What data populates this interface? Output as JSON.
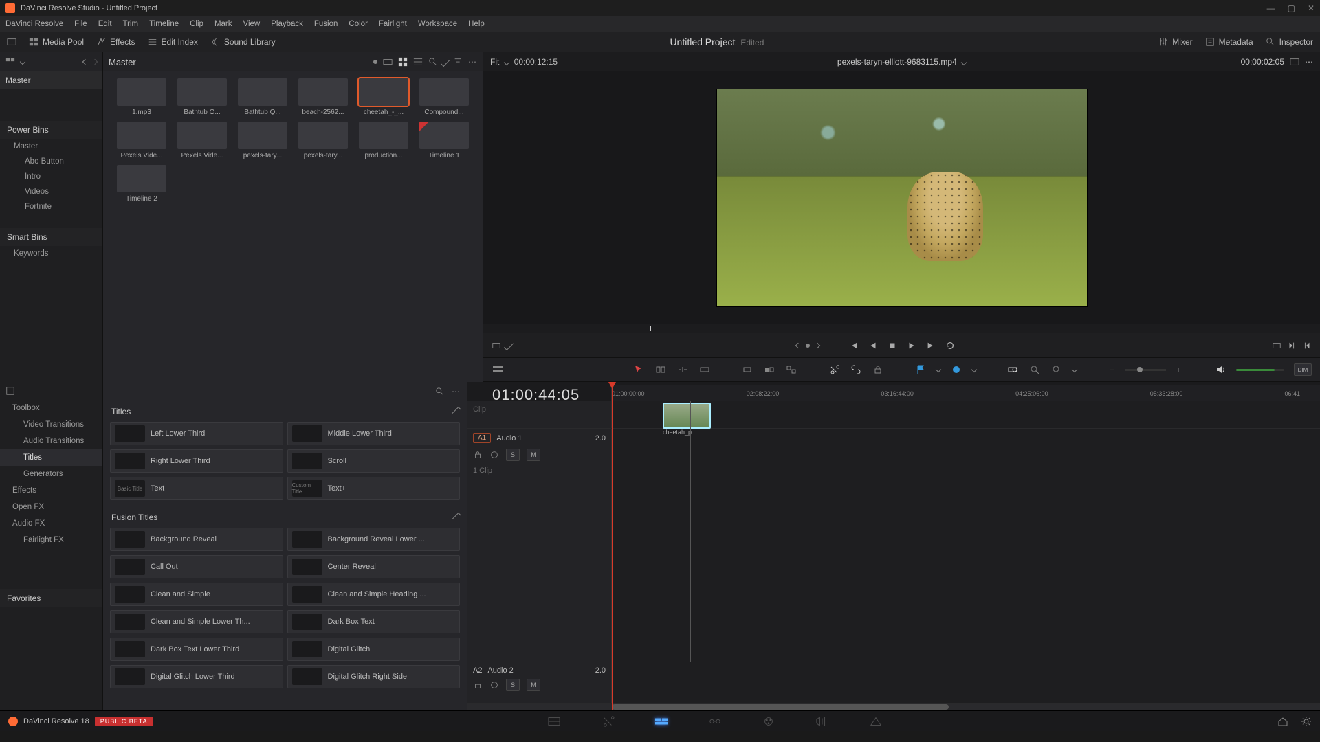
{
  "window": {
    "title": "DaVinci Resolve Studio - Untitled Project"
  },
  "menubar": [
    "DaVinci Resolve",
    "File",
    "Edit",
    "Trim",
    "Timeline",
    "Clip",
    "Mark",
    "View",
    "Playback",
    "Fusion",
    "Color",
    "Fairlight",
    "Workspace",
    "Help"
  ],
  "toolbar": {
    "media_pool": "Media Pool",
    "effects": "Effects",
    "edit_index": "Edit Index",
    "sound_library": "Sound Library",
    "project": "Untitled Project",
    "edited": "Edited",
    "mixer": "Mixer",
    "metadata": "Metadata",
    "inspector": "Inspector"
  },
  "bins": {
    "breadcrumb": "Master",
    "root": "Master",
    "power_title": "Power Bins",
    "power_items": [
      "Master",
      "Abo Button",
      "Intro",
      "Videos",
      "Fortnite"
    ],
    "smart_title": "Smart Bins",
    "smart_items": [
      "Keywords"
    ]
  },
  "mediapool": {
    "thumbs": [
      {
        "label": "1.mp3",
        "cls": "t-audio"
      },
      {
        "label": "Bathtub O...",
        "cls": "t-dark"
      },
      {
        "label": "Bathtub Q...",
        "cls": "t-dark"
      },
      {
        "label": "beach-2562...",
        "cls": "t-beach"
      },
      {
        "label": "cheetah_-_...",
        "cls": "t-cheetah",
        "sel": true
      },
      {
        "label": "Compound...",
        "cls": "t-comp"
      },
      {
        "label": "Pexels Vide...",
        "cls": "t-grey"
      },
      {
        "label": "Pexels Vide...",
        "cls": "t-grey"
      },
      {
        "label": "pexels-tary...",
        "cls": "t-grey"
      },
      {
        "label": "pexels-tary...",
        "cls": "t-grey"
      },
      {
        "label": "production...",
        "cls": "t-cheetah"
      },
      {
        "label": "Timeline 1",
        "cls": "t-tl"
      },
      {
        "label": "Timeline 2",
        "cls": "t-grey"
      }
    ]
  },
  "viewer": {
    "fit": "Fit",
    "src_tc": "00:00:12:15",
    "clip_name": "pexels-taryn-elliott-9683115.mp4",
    "rec_tc": "00:00:02:05"
  },
  "timeline": {
    "tc": "01:00:44:05",
    "ruler": [
      "01:00:00:00",
      "02:08:22:00",
      "03:16:44:00",
      "04:25:06:00",
      "05:33:28:00",
      "06:41"
    ],
    "a1_label": "A1",
    "a1_name": "Audio 1",
    "a1_gain": "2.0",
    "a1_clips": "1 Clip",
    "a2_label": "A2",
    "a2_name": "Audio 2",
    "a2_gain": "2.0",
    "drag_clip": "cheetah_p...",
    "btn_s": "S",
    "btn_m": "M"
  },
  "fx": {
    "search_ph": "Search",
    "cats": [
      {
        "name": "Toolbox",
        "exp": true
      },
      {
        "name": "Video Transitions",
        "child": true
      },
      {
        "name": "Audio Transitions",
        "child": true
      },
      {
        "name": "Titles",
        "child": true,
        "sel": true
      },
      {
        "name": "Generators",
        "child": true
      },
      {
        "name": "Effects",
        "exp": true
      },
      {
        "name": "Open FX",
        "exp": true
      },
      {
        "name": "Audio FX",
        "exp": true
      },
      {
        "name": "Fairlight FX",
        "child": true
      }
    ],
    "fav_title": "Favorites",
    "titles_hdr": "Titles",
    "fusion_hdr": "Fusion Titles",
    "titles": [
      "Left Lower Third",
      "Middle Lower Third",
      "Right Lower Third",
      "Scroll",
      "Text",
      "Text+"
    ],
    "titles_sw": [
      "",
      "",
      "",
      "",
      "Basic Title",
      "Custom Title"
    ],
    "fusion": [
      "Background Reveal",
      "Background Reveal Lower ...",
      "Call Out",
      "Center Reveal",
      "Clean and Simple",
      "Clean and Simple Heading ...",
      "Clean and Simple Lower Th...",
      "Dark Box Text",
      "Dark Box Text Lower Third",
      "Digital Glitch",
      "Digital Glitch Lower Third",
      "Digital Glitch Right Side"
    ]
  },
  "bottom": {
    "ver": "DaVinci Resolve 18",
    "badge": "PUBLIC BETA"
  }
}
